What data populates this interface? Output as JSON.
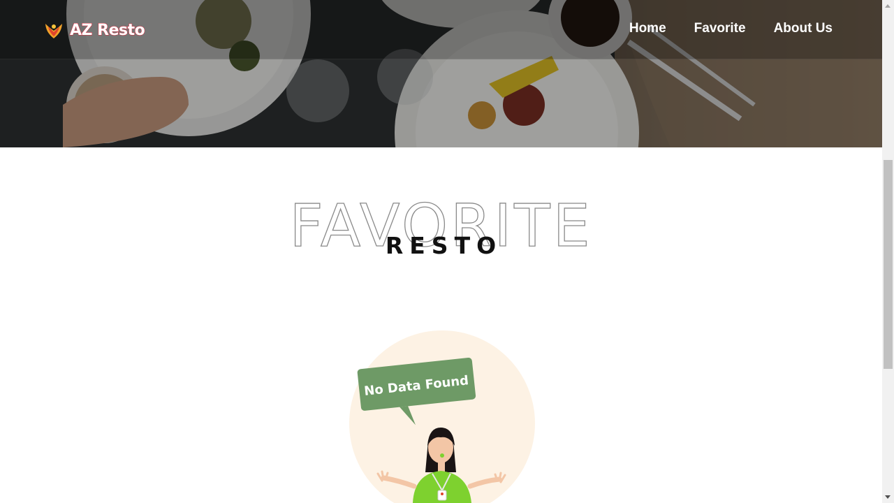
{
  "navbar": {
    "brand": "AZ Resto",
    "logo_icon": "phoenix-icon",
    "links": [
      "Home",
      "Favorite",
      "About Us"
    ]
  },
  "section": {
    "outline_title": "FAVORITE",
    "main_title": "RESTO"
  },
  "empty_state": {
    "message": "No Data Found"
  },
  "colors": {
    "brand_stroke": "#e0283d",
    "bubble": "#6e9a66",
    "circle_bg": "#fdf1e3",
    "shirt": "#7ed12f"
  }
}
